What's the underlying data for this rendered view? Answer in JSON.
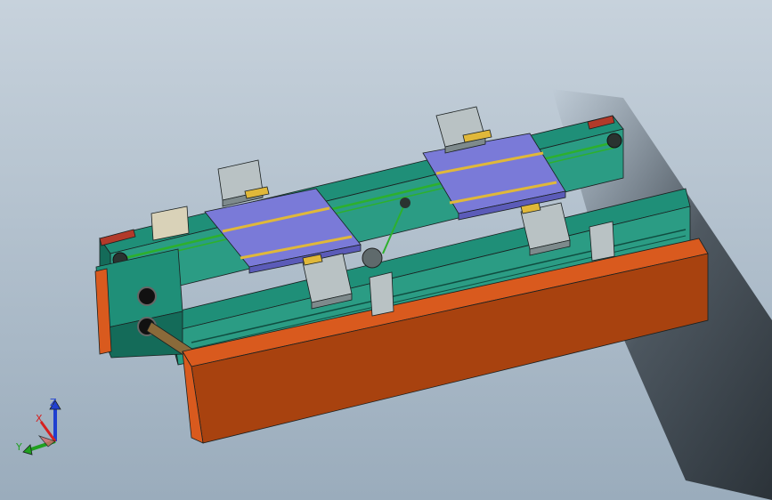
{
  "viewport": {
    "background_top": "#c7d2dc",
    "background_bottom": "#9aacbc"
  },
  "model": {
    "colors": {
      "rail_green": "#1f8f78",
      "rail_green_dark": "#146b59",
      "rail_side": "#2b9c84",
      "plate_blue": "#7a7ad8",
      "plate_blue_dark": "#5b5bb8",
      "base_orange": "#d95a1e",
      "base_orange_dark": "#a8420f",
      "cylinder_grey": "#b9c2c4",
      "cylinder_dark": "#7e8a8c",
      "accent_yellow": "#e0b83a",
      "belt_green": "#2db02d",
      "block_tan": "#d9d2b8"
    }
  },
  "triad": {
    "x_label": "X",
    "y_label": "Y",
    "z_label": "Z",
    "x_color": "#d62020",
    "y_color": "#20a020",
    "z_color": "#2040d0"
  }
}
